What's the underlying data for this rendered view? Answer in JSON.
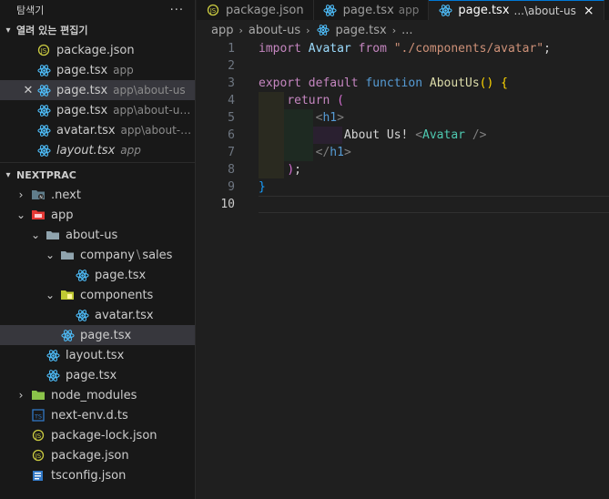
{
  "sidebar": {
    "title": "탐색기",
    "more": "···",
    "open_editors_title": "열려 있는 편집기",
    "open_editors": [
      {
        "label": "package.json",
        "desc": "",
        "icon": "json-icon"
      },
      {
        "label": "page.tsx",
        "desc": "app",
        "icon": "react-icon"
      },
      {
        "label": "page.tsx",
        "desc": "app\\about-us",
        "icon": "react-icon",
        "selected": true
      },
      {
        "label": "page.tsx",
        "desc": "app\\about-us\\co...",
        "icon": "react-icon"
      },
      {
        "label": "avatar.tsx",
        "desc": "app\\about-us\\c...",
        "icon": "react-icon"
      },
      {
        "label": "layout.tsx",
        "desc": "app",
        "icon": "react-icon",
        "italic": true
      }
    ],
    "project_title": "NEXTPRAC",
    "tree": [
      {
        "label": ".next",
        "type": "folder",
        "icon": "next-folder-icon"
      },
      {
        "label": "app",
        "type": "folder-open",
        "icon": "app-folder-icon"
      },
      {
        "label": "about-us",
        "type": "folder-open",
        "icon": "folder-icon"
      },
      {
        "label": "company",
        "label2": "sales",
        "sep": "\\",
        "type": "folder-open",
        "icon": "folder-icon"
      },
      {
        "label": "page.tsx",
        "type": "file",
        "icon": "react-icon"
      },
      {
        "label": "components",
        "type": "folder-open",
        "icon": "components-folder-icon"
      },
      {
        "label": "avatar.tsx",
        "type": "file",
        "icon": "react-icon"
      },
      {
        "label": "page.tsx",
        "type": "file",
        "icon": "react-icon"
      },
      {
        "label": "layout.tsx",
        "type": "file",
        "icon": "react-icon"
      },
      {
        "label": "page.tsx",
        "type": "file",
        "icon": "react-icon"
      },
      {
        "label": "node_modules",
        "type": "folder",
        "icon": "node-folder-icon"
      },
      {
        "label": "next-env.d.ts",
        "type": "file",
        "icon": "ts-icon"
      },
      {
        "label": "package-lock.json",
        "type": "file",
        "icon": "json-icon"
      },
      {
        "label": "package.json",
        "type": "file",
        "icon": "json-icon"
      },
      {
        "label": "tsconfig.json",
        "type": "file",
        "icon": "tsconfig-icon"
      }
    ]
  },
  "tabs": [
    {
      "label": "package.json",
      "desc": ""
    },
    {
      "label": "page.tsx",
      "desc": "app"
    },
    {
      "label": "page.tsx",
      "desc": "...\\about-us",
      "active": true,
      "close": "×"
    }
  ],
  "breadcrumb": [
    "app",
    "about-us",
    "page.tsx",
    "..."
  ],
  "editor": {
    "line_numbers": [
      "1",
      "2",
      "3",
      "4",
      "5",
      "6",
      "7",
      "8",
      "9",
      "10"
    ],
    "code": {
      "l1_import": "import",
      "l1_name": "Avatar",
      "l1_from": "from",
      "l1_path": "\"./components/avatar\"",
      "l1_semi": ";",
      "l3_export": "export",
      "l3_default": "default",
      "l3_function": "function",
      "l3_name": "AboutUs",
      "l3_parens": "()",
      "l3_brace": "{",
      "l4_return": "return",
      "l4_paren": "(",
      "l5_open": "<",
      "l5_tag": "h1",
      "l5_close": ">",
      "l6_text": "About Us! ",
      "l6_open": "<",
      "l6_comp": "Avatar",
      "l6_close": " />",
      "l7_open": "</",
      "l7_tag": "h1",
      "l7_close": ">",
      "l8_paren": ")",
      "l8_semi": ";",
      "l9_brace": "}"
    }
  },
  "colors": {
    "accent": "#0078d4",
    "react": "#4fc1ff",
    "json": "#cbcb41",
    "folder": "#c09553"
  }
}
